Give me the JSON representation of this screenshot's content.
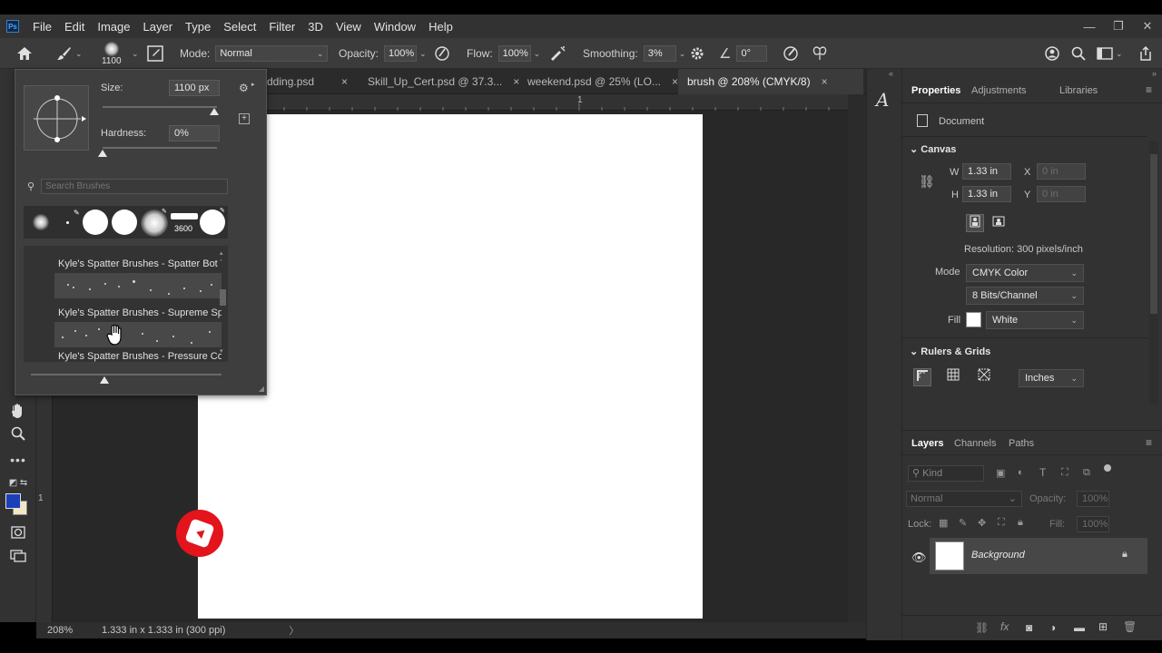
{
  "menu": {
    "logo": "Ps",
    "items": [
      "File",
      "Edit",
      "Image",
      "Layer",
      "Type",
      "Select",
      "Filter",
      "3D",
      "View",
      "Window",
      "Help"
    ]
  },
  "window_controls": {
    "minimize": "—",
    "restore": "❐",
    "close": "✕"
  },
  "options": {
    "brush_size": "1100",
    "mode_label": "Mode:",
    "mode_value": "Normal",
    "opacity_label": "Opacity:",
    "opacity_value": "100%",
    "flow_label": "Flow:",
    "flow_value": "100%",
    "smoothing_label": "Smoothing:",
    "smoothing_value": "3%",
    "angle_value": "0°"
  },
  "tabs": [
    {
      "label": "dding.psd",
      "close": "×"
    },
    {
      "label": "Skill_Up_Cert.psd @ 37.3...",
      "close": "×"
    },
    {
      "label": "weekend.psd @ 25% (LO...",
      "close": "×"
    },
    {
      "label": "brush @ 208% (CMYK/8)",
      "close": "×"
    }
  ],
  "ruler": {
    "top_mark": "1",
    "left_mark": "1"
  },
  "status": {
    "zoom": "208%",
    "info": "1.333 in x 1.333 in (300 ppi)",
    "arrow": "〉"
  },
  "brush_picker": {
    "size_label": "Size:",
    "size_value": "1100 px",
    "hardness_label": "Hardness:",
    "hardness_value": "0%",
    "size_fraction": 0.98,
    "hardness_fraction": 0.0,
    "search_placeholder": "Search Brushes",
    "preset_count_label": "3600",
    "rows": [
      {
        "label": "Kyle's Spatter Brushes - Spatter Bot Tilt"
      },
      {
        "label": "Kyle's Spatter Brushes - Supreme Spatter"
      },
      {
        "label": "Kyle's Spatter Brushes - Pressure Control"
      }
    ]
  },
  "properties": {
    "tabs": [
      "Properties",
      "Adjustments",
      "Libraries"
    ],
    "document_label": "Document",
    "canvas_title": "Canvas",
    "w_label": "W",
    "w_value": "1.33 in",
    "h_label": "H",
    "h_value": "1.33 in",
    "x_label": "X",
    "x_value": "0 in",
    "y_label": "Y",
    "y_value": "0 in",
    "resolution": "Resolution: 300 pixels/inch",
    "mode_label": "Mode",
    "mode_value": "CMYK Color",
    "bits_value": "8 Bits/Channel",
    "fill_label": "Fill",
    "fill_value": "White",
    "rulers_title": "Rulers & Grids",
    "units_value": "Inches"
  },
  "layers": {
    "tabs": [
      "Layers",
      "Channels",
      "Paths"
    ],
    "kind_placeholder": "Kind",
    "blend_mode": "Normal",
    "opacity_label": "Opacity:",
    "opacity_value": "100%",
    "lock_label": "Lock:",
    "fill_label": "Fill:",
    "fill_value": "100%",
    "layer_name": "Background"
  },
  "colors": {
    "foreground": "#1b3fb8",
    "background": "#f2e8c4",
    "accent_red": "#e3141b"
  }
}
